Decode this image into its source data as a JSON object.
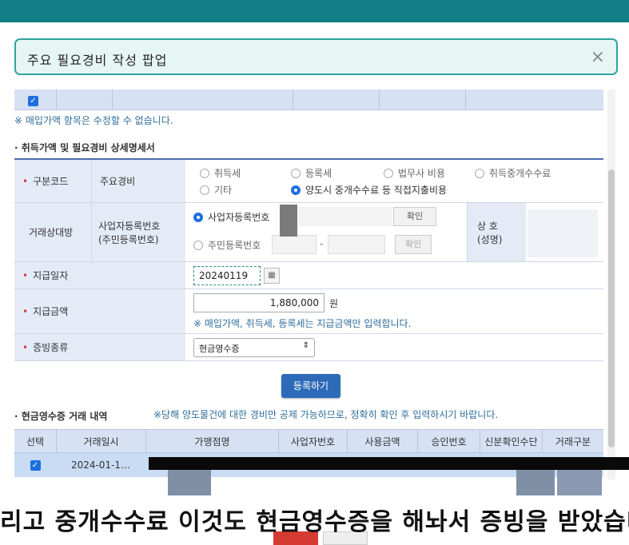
{
  "popup": {
    "title": "주요 필요경비 작성 팝업",
    "close_icon": "×"
  },
  "top_note": "※ 매입가액 항목은 수정할 수 없습니다.",
  "section1_title": "· 취득가액 및 필요경비 상세명세서",
  "form": {
    "code_label": "구분코드",
    "main_expense_label": "주요경비",
    "radios": [
      {
        "label": "취득세",
        "checked": false
      },
      {
        "label": "등록세",
        "checked": false
      },
      {
        "label": "법무사 비용",
        "checked": false
      },
      {
        "label": "취득중개수수료",
        "checked": false
      },
      {
        "label": "기타",
        "checked": false
      },
      {
        "label": "양도시 중개수수료 등 직접지출비용",
        "checked": true
      }
    ],
    "counterparty_label": "거래상대방",
    "bizno_label": "사업자등록번호\n(주민등록번호)",
    "radio_bizno": "사업자등록번호",
    "radio_resno": "주민등록번호",
    "confirm_btn": "확인",
    "confirm_btn2": "확인",
    "dash": "-",
    "trade_name_label": "상 호\n(성명)",
    "pay_date_label": "지급일자",
    "pay_date_value": "20240119",
    "pay_amount_label": "지급금액",
    "pay_amount_value": "1,880,000",
    "pay_amount_unit": "원",
    "pay_amount_note": "※ 매입가액, 취득세, 등록세는 지급금액만 입력합니다.",
    "evidence_label": "증빙종류",
    "evidence_value": "현금영수증"
  },
  "register_btn": "등록하기",
  "section2_title": "· 현금영수증 거래 내역",
  "section2_note": "※당해 양도물건에 대한 경비만 공제 가능하므로, 정확히 확인 후 입력하시기 바랍니다.",
  "list": {
    "headers": [
      "선택",
      "거래일시",
      "가맹점명",
      "사업자번호",
      "사용금액",
      "승인번호",
      "신분확인수단",
      "거래구분"
    ],
    "row": {
      "date": "2024-01-1…"
    }
  },
  "subtitle": "리고 중개수수료 이것도 현금영수증을 해놔서 증빙을 받았습니다"
}
